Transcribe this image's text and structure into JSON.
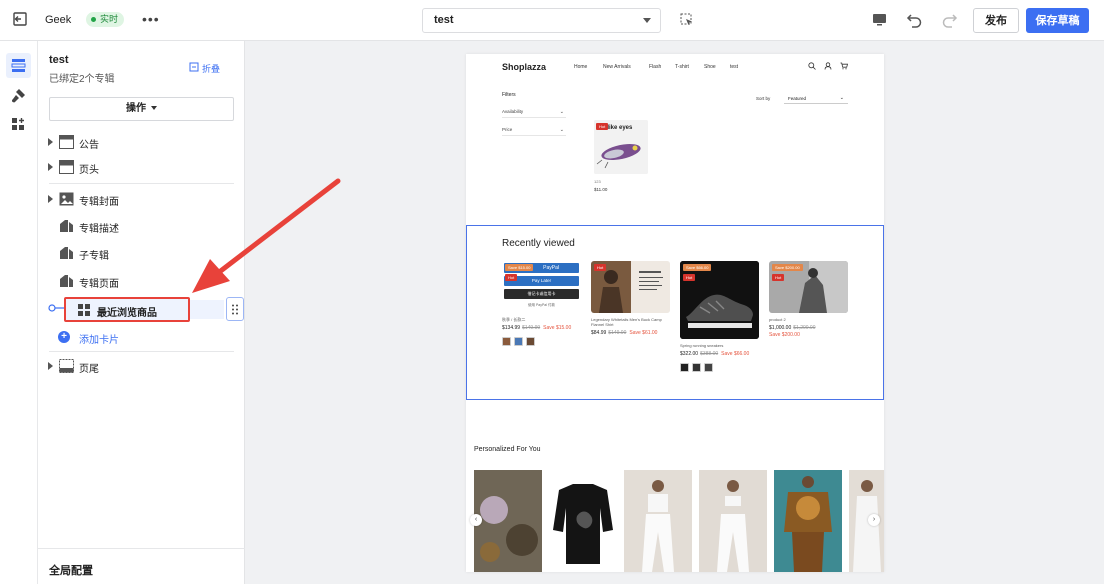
{
  "topbar": {
    "store_name": "Geek",
    "live_label": "实时",
    "more_label": "•••",
    "theme_name": "test",
    "publish_label": "发布",
    "save_draft_label": "保存草稿"
  },
  "rail": {
    "items": [
      {
        "icon": "sections-icon",
        "active": true
      },
      {
        "icon": "theme-brush-icon",
        "active": false
      },
      {
        "icon": "apps-icon",
        "active": false
      }
    ]
  },
  "panel": {
    "title": "test",
    "subtitle": "已绑定2个专辑",
    "collapse_label": "折叠",
    "actions_label": "操作",
    "header_sections": [
      {
        "label": "公告",
        "icon": "announcement-icon",
        "expandable": true
      },
      {
        "label": "页头",
        "icon": "header-icon",
        "expandable": true
      }
    ],
    "template_sections": [
      {
        "label": "专辑封面",
        "icon": "image-icon",
        "expandable": true
      },
      {
        "label": "专辑描述",
        "icon": "tag-icon",
        "expandable": false
      },
      {
        "label": "子专辑",
        "icon": "tag-icon",
        "expandable": false
      },
      {
        "label": "专辑页面",
        "icon": "tag-icon",
        "expandable": false
      }
    ],
    "selected_card": "最近浏览商品",
    "add_card_label": "添加卡片",
    "footer_section": {
      "label": "页尾",
      "icon": "footer-icon",
      "expandable": true
    },
    "global_config_label": "全局配置"
  },
  "preview": {
    "logo": "Shoplazza",
    "nav": [
      "Home",
      "New Arrivals",
      "Flash",
      "T-shirt",
      "Shoe",
      "test"
    ],
    "filters_title": "Filters",
    "filters": [
      "Availability",
      "Price"
    ],
    "sort_by_label": "Sort by",
    "sort_value": "Featured",
    "collection_product": {
      "badge": "Hot",
      "image_text": "elike eyes",
      "name": "123",
      "price": "$11.00"
    },
    "recently_viewed": {
      "title": "Recently viewed",
      "items": [
        {
          "badge": "Save $15.00",
          "hot": "Hot",
          "name": "秋季 / 长款二",
          "price": "$134.99",
          "compare": "$149.99",
          "save": "Save $15.00",
          "swatches": [
            "#8a5a3c",
            "#4a78b5",
            "#6b4a33"
          ],
          "paypal_label": "PayPal",
          "pay_later_label": "Pay Later",
          "debit_card_label": "借记卡或信用卡",
          "paypal_note": "使用 PayPal 付款"
        },
        {
          "badge": "",
          "hot": "Hot",
          "name": "Legendary Whitetails Men's Buck Camp Flannel Shirt",
          "price": "$84.99",
          "compare": "$149.00",
          "save": "Save $61.00",
          "swatches": []
        },
        {
          "badge": "Save $66.00",
          "hot": "Hot",
          "name": "Spring running sneakers",
          "price": "$322.00",
          "compare": "$388.00",
          "save": "Save $66.00",
          "swatches": [
            "#222222",
            "#333333",
            "#444444"
          ]
        },
        {
          "badge": "Save $200.00",
          "hot": "Hot",
          "name": "product 2",
          "price": "$1,000.00",
          "compare": "$1,200.00",
          "save": "Save $200.00",
          "swatches": []
        }
      ]
    },
    "personalized": {
      "title": "Personalized For You"
    }
  },
  "colors": {
    "accent": "#3c6ff2",
    "annotation": "#e8423a",
    "live": "#22a447"
  }
}
